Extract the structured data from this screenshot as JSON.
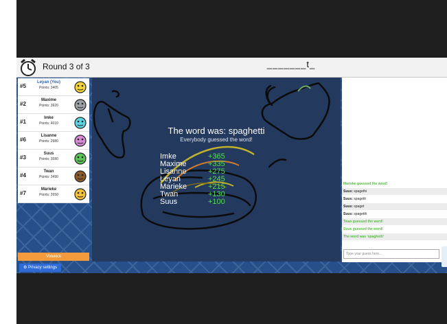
{
  "header": {
    "round_label": "Round 3 of 3",
    "word_hint": "_______t_"
  },
  "players": [
    {
      "rank": "#5",
      "name": "Leyan (You)",
      "points": "Points: 3405",
      "avatar_color": "#f2d33b",
      "me": true
    },
    {
      "rank": "#2",
      "name": "Maxime",
      "points": "Points: 3920",
      "avatar_color": "#9aa0a6",
      "me": false
    },
    {
      "rank": "#1",
      "name": "Imke",
      "points": "Points: 4010",
      "avatar_color": "#5fd3e0",
      "me": false
    },
    {
      "rank": "#6",
      "name": "Lisanne",
      "points": "Points: 2980",
      "avatar_color": "#d58bd3",
      "me": false
    },
    {
      "rank": "#3",
      "name": "Suus",
      "points": "Points: 3580",
      "avatar_color": "#5cc35a",
      "me": false
    },
    {
      "rank": "#4",
      "name": "Twan",
      "points": "Points: 3490",
      "avatar_color": "#8a5a2b",
      "me": false
    },
    {
      "rank": "#7",
      "name": "Marieke",
      "points": "Points: 2650",
      "avatar_color": "#f2c23b",
      "me": false
    }
  ],
  "sidebar": {
    "vote_label": "Votekick",
    "privacy_label": "Privacy settings"
  },
  "result": {
    "title": "The word was: spaghetti",
    "subtitle": "Everybody guessed the word!",
    "scores": [
      {
        "name": "Imke",
        "score": "+365"
      },
      {
        "name": "Maxime",
        "score": "+335"
      },
      {
        "name": "Lisanne",
        "score": "+275"
      },
      {
        "name": "Leyan",
        "score": "+245"
      },
      {
        "name": "Marieke",
        "score": "+215"
      },
      {
        "name": "Twan",
        "score": "+130"
      },
      {
        "name": "Suus",
        "score": "+100"
      }
    ]
  },
  "chat": {
    "messages": [
      {
        "type": "sys",
        "text": "Marieke guessed the word!"
      },
      {
        "type": "user",
        "who": "Suus:",
        "text": "spagethi"
      },
      {
        "type": "user",
        "who": "Suus:",
        "text": "spagetti"
      },
      {
        "type": "user",
        "who": "Suus:",
        "text": "spaget"
      },
      {
        "type": "user",
        "who": "Suus:",
        "text": "spagetth"
      },
      {
        "type": "sys",
        "text": "Twan guessed the word!"
      },
      {
        "type": "sys",
        "text": "Suus guessed the word!"
      },
      {
        "type": "sys",
        "text": "The word was 'spaghetti'"
      }
    ],
    "input_placeholder": "Type your guess here..."
  },
  "colors": {
    "background": "#27508a",
    "canvas": "#23395d",
    "score_green": "#59d95f",
    "vote_orange": "#f29a3c"
  }
}
